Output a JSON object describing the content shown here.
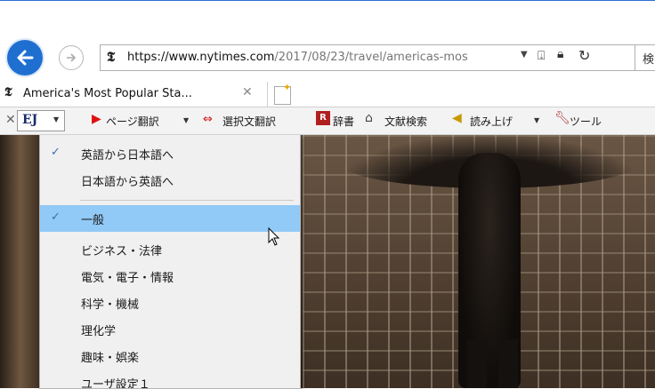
{
  "browser": {
    "address": {
      "url_host_part": "https://www.nytimes.com",
      "url_path_part": "/2017/08/23/travel/americas-mos",
      "search_partial": "検"
    },
    "tab": {
      "title": "America's Most Popular Sta..."
    }
  },
  "toolbar": {
    "ej_label": "EJ",
    "page_translate": "ページ翻訳",
    "selected_translate": "選択文翻訳",
    "dictionary": "辞書",
    "literature_search": "文献検索",
    "read_aloud": "読み上げ",
    "tools": "ツール"
  },
  "menu": {
    "items": [
      {
        "label": "英語から日本語へ",
        "checked": true
      },
      {
        "label": "日本語から英語へ",
        "checked": false
      },
      {
        "label": "一般",
        "checked": true,
        "highlighted": true
      },
      {
        "label": "ビジネス・法律",
        "checked": false
      },
      {
        "label": "電気・電子・情報",
        "checked": false
      },
      {
        "label": "科学・機械",
        "checked": false
      },
      {
        "label": "理化学",
        "checked": false
      },
      {
        "label": "趣味・娯楽",
        "checked": false
      },
      {
        "label": "ユーザ設定１",
        "checked": false
      }
    ]
  },
  "icons": {
    "back": "back-arrow-icon",
    "forward": "forward-arrow-icon",
    "lock": "lock-icon",
    "refresh": "refresh-icon"
  },
  "colors": {
    "accent_blue": "#1f6fd1",
    "menu_highlight": "#91c9f7"
  }
}
